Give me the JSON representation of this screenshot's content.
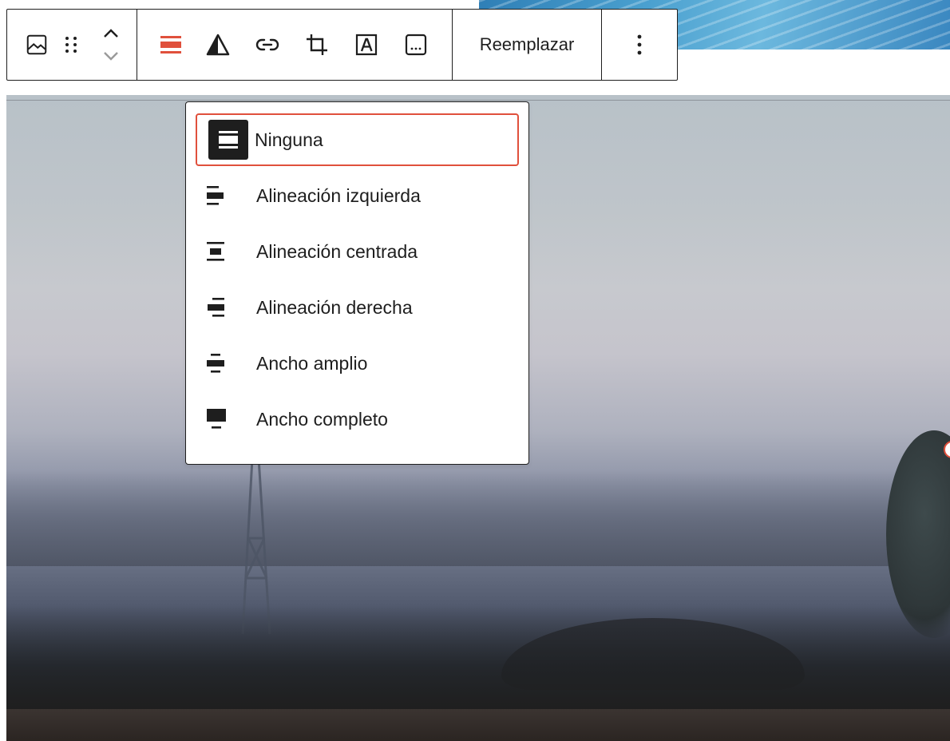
{
  "colors": {
    "accent": "#e0503c",
    "ink": "#1e1e1e",
    "surface": "#ffffff"
  },
  "toolbar": {
    "block_type_icon": "image-icon",
    "drag_handle_icon": "drag-handle-icon",
    "move_up_icon": "chevron-up-icon",
    "move_down_icon": "chevron-down-icon",
    "tools": [
      {
        "name": "align-button",
        "icon": "align-none-icon",
        "active": true
      },
      {
        "name": "duotone-button",
        "icon": "duotone-filter-icon"
      },
      {
        "name": "link-button",
        "icon": "link-icon"
      },
      {
        "name": "crop-button",
        "icon": "crop-icon"
      },
      {
        "name": "text-overlay-button",
        "icon": "text-over-image-icon"
      },
      {
        "name": "caption-button",
        "icon": "caption-icon"
      }
    ],
    "replace_label": "Reemplazar",
    "more_icon": "more-vertical-icon"
  },
  "alignment_menu": {
    "selected": "Ninguna",
    "items": [
      {
        "label": "Ninguna",
        "icon": "align-none-icon"
      },
      {
        "label": "Alineación izquierda",
        "icon": "align-left-icon"
      },
      {
        "label": "Alineación centrada",
        "icon": "align-center-icon"
      },
      {
        "label": "Alineación derecha",
        "icon": "align-right-icon"
      },
      {
        "label": "Ancho amplio",
        "icon": "align-wide-icon"
      },
      {
        "label": "Ancho completo",
        "icon": "align-full-width-icon"
      }
    ]
  }
}
